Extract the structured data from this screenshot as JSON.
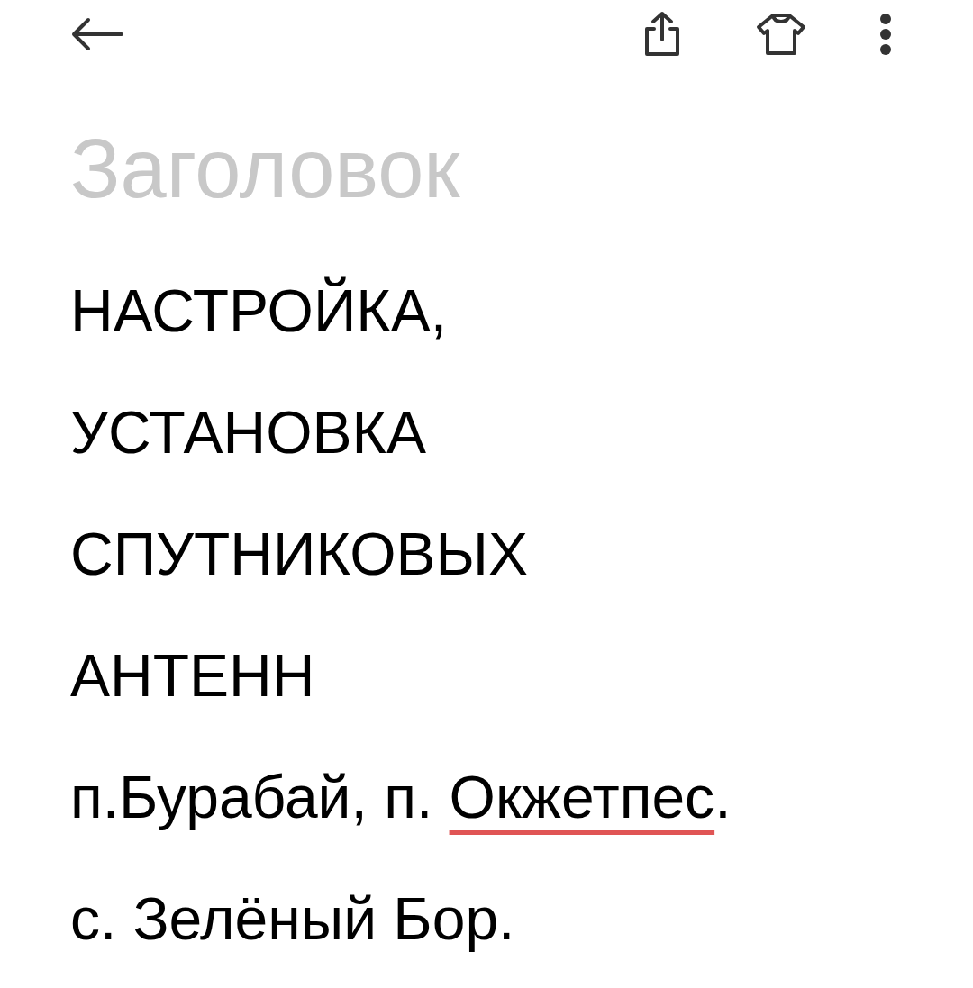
{
  "toolbar": {
    "actions": [
      {
        "kind": "share"
      },
      {
        "kind": "theme"
      },
      {
        "kind": "more"
      }
    ]
  },
  "title": {
    "placeholder": "Заголовок"
  },
  "body": {
    "lines": [
      [
        {
          "text": "НАСТРОЙКА,"
        }
      ],
      [
        {
          "text": "УСТАНОВКА"
        }
      ],
      [
        {
          "text": "СПУТНИКОВЫХ"
        }
      ],
      [
        {
          "text": "АНТЕНН"
        }
      ],
      [
        {
          "text": "п.Бурабай, п. ",
          "misspelled": false
        },
        {
          "text": "Окжетпес",
          "misspelled": true
        },
        {
          "text": ".",
          "misspelled": false
        }
      ],
      [
        {
          "text": "с. Зелёный Бор."
        }
      ]
    ]
  }
}
